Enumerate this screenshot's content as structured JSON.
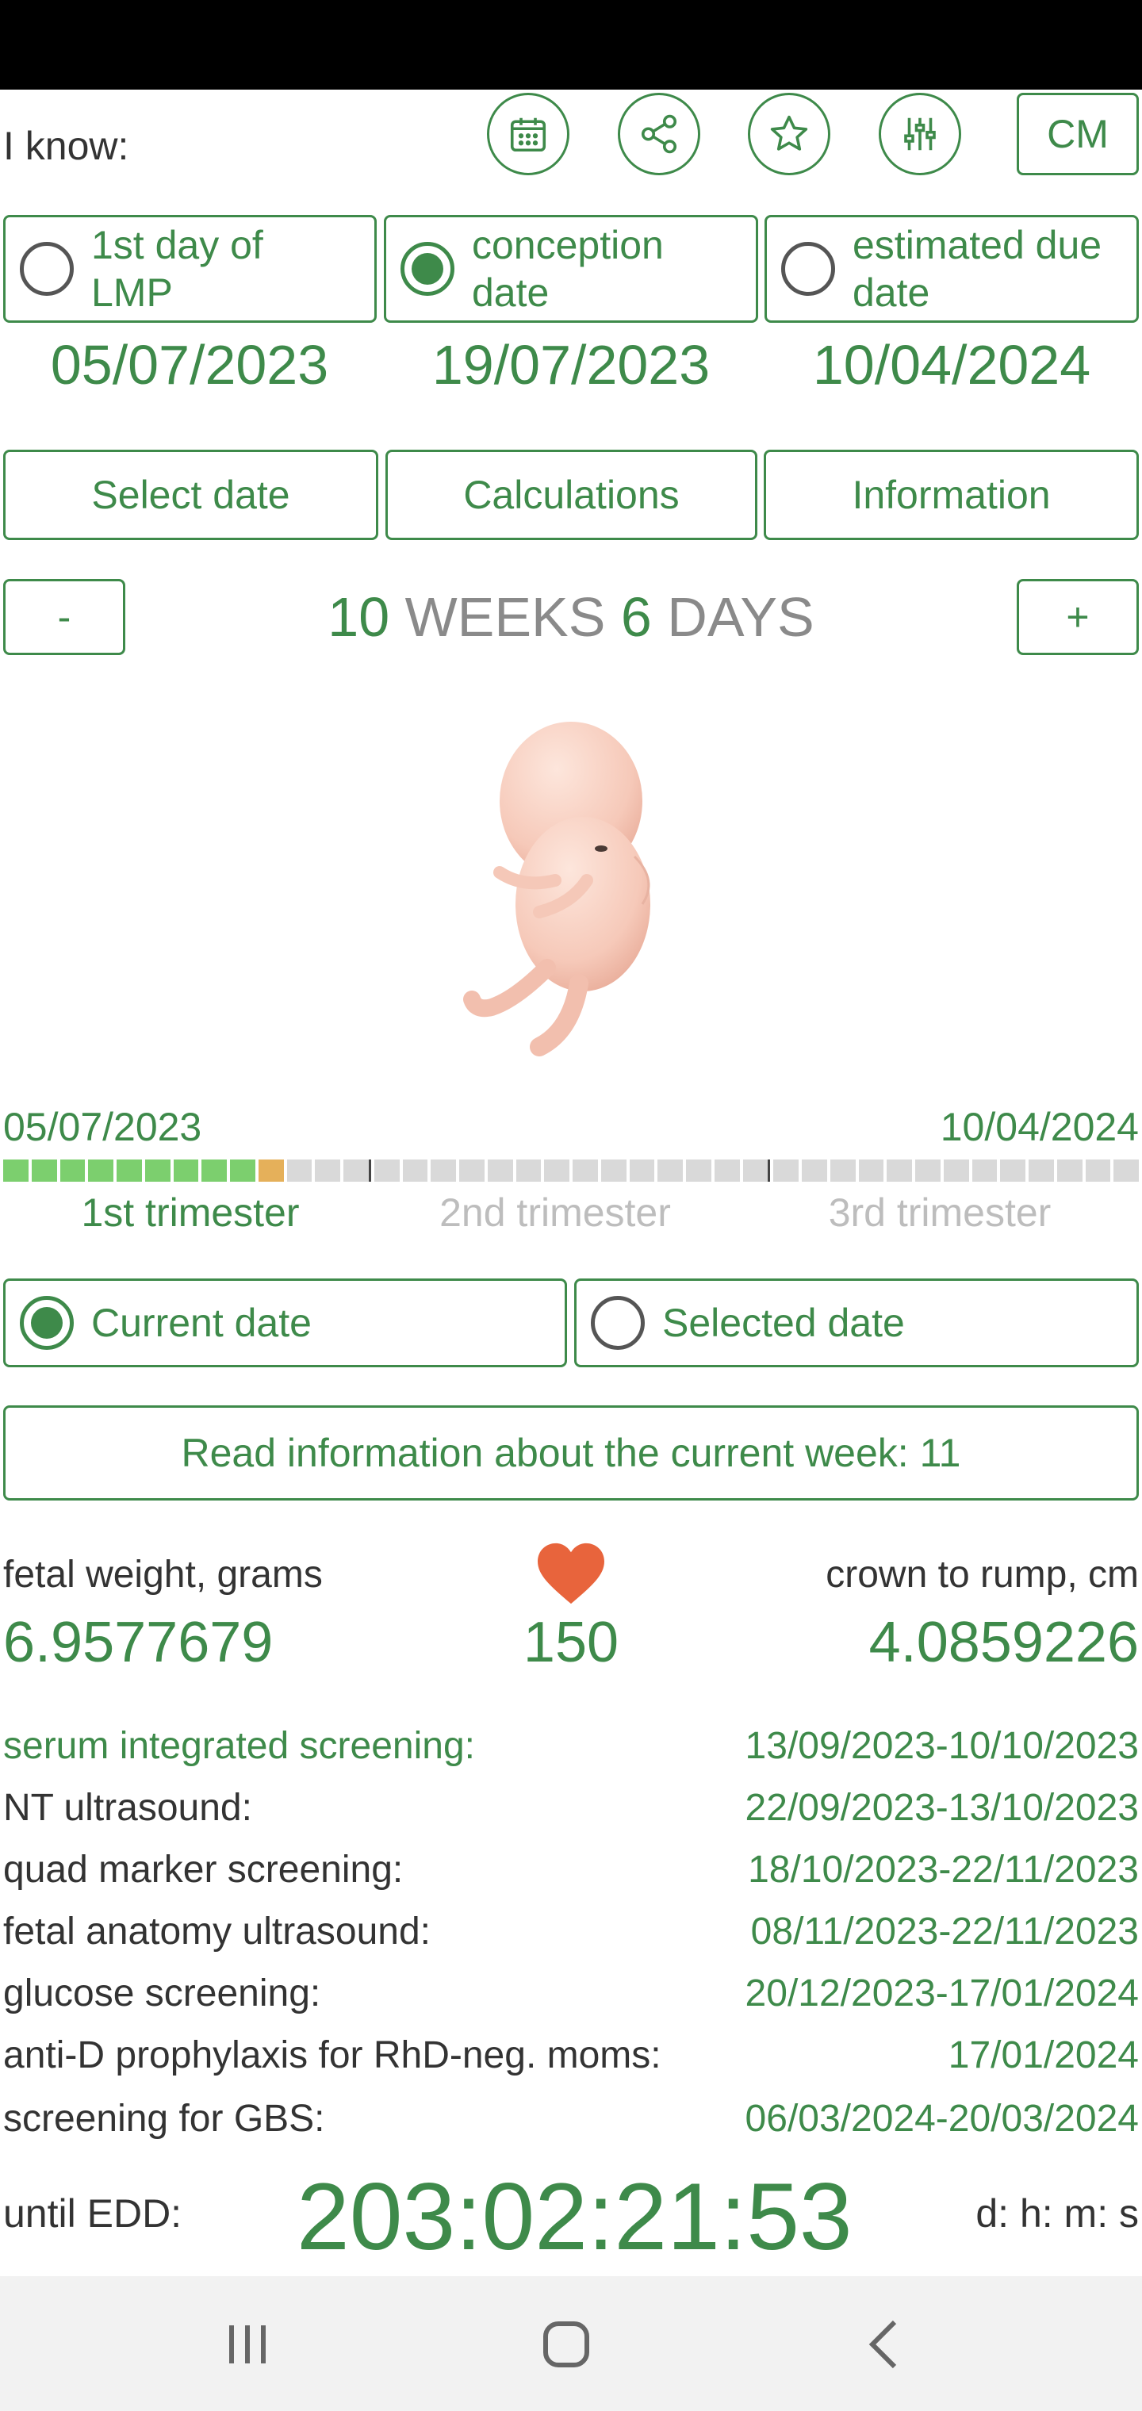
{
  "toolbar": {
    "i_know": "I know:",
    "icons": [
      "calendar-icon",
      "share-icon",
      "star-icon",
      "equalizer-icon"
    ],
    "unit_button": "CM"
  },
  "known_options": [
    {
      "label": "1st day of LMP",
      "selected": false,
      "date": "05/07/2023"
    },
    {
      "label": "conception date",
      "selected": true,
      "date": "19/07/2023"
    },
    {
      "label": "estimated due date",
      "selected": false,
      "date": "10/04/2024"
    }
  ],
  "actions": {
    "select_date": "Select date",
    "calculations": "Calculations",
    "information": "Information"
  },
  "week_nav": {
    "minus": "-",
    "plus": "+",
    "weeks_num": "10",
    "weeks_word": "WEEKS",
    "days_num": "6",
    "days_word": "DAYS"
  },
  "timeline": {
    "start_date": "05/07/2023",
    "end_date": "10/04/2024",
    "segments_total": 40,
    "completed_segments": 9,
    "current_segment": 10,
    "trimesters": [
      "1st trimester",
      "2nd trimester",
      "3rd trimester"
    ],
    "active_trimester": 1
  },
  "date_mode": {
    "current": "Current date",
    "selected": "Selected date",
    "current_selected": true
  },
  "read_info": "Read information about the current week: 11",
  "stats": {
    "weight_label": "fetal weight, grams",
    "weight_value": "6.9577679",
    "heart_rate": "150",
    "crl_label": "crown to rump, cm",
    "crl_value": "4.0859226"
  },
  "screenings": [
    {
      "name": "serum integrated screening:",
      "dates": "13/09/2023-10/10/2023"
    },
    {
      "name": "NT ultrasound:",
      "dates": "22/09/2023-13/10/2023"
    },
    {
      "name": "quad marker screening:",
      "dates": "18/10/2023-22/11/2023"
    },
    {
      "name": "fetal anatomy ultrasound:",
      "dates": "08/11/2023-22/11/2023"
    },
    {
      "name": "glucose screening:",
      "dates": "20/12/2023-17/01/2024"
    },
    {
      "name": "anti-D prophylaxis for RhD-neg. moms:",
      "dates": "17/01/2024"
    },
    {
      "name": "screening for GBS:",
      "dates": "06/03/2024-20/03/2024"
    }
  ],
  "edd": {
    "label": "until EDD:",
    "countdown": "203:02:21:53",
    "unit": "d: h: m: s"
  },
  "colors": {
    "accent": "#3e8a4a",
    "progress_done": "#7ccf6e",
    "progress_current": "#e5b05a",
    "progress_todo": "#d9d9d9",
    "heart": "#e8643c"
  }
}
